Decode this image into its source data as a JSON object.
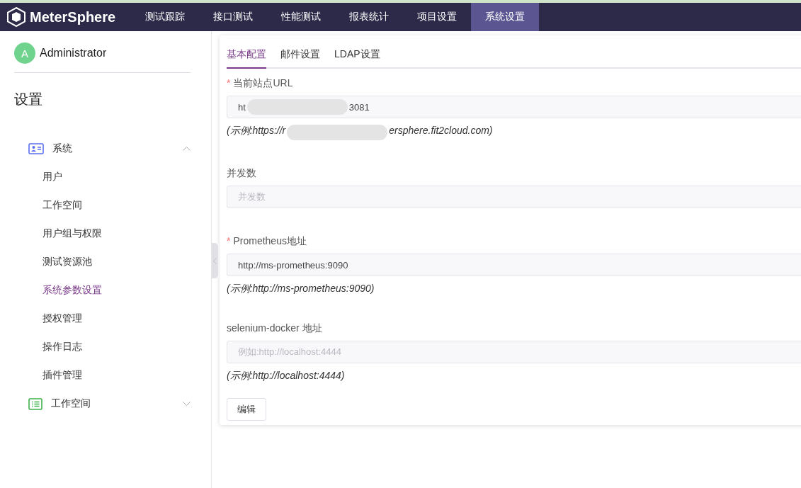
{
  "header": {
    "logo": "MeterSphere",
    "nav": [
      {
        "label": "测试跟踪",
        "selected": false
      },
      {
        "label": "接口测试",
        "selected": false
      },
      {
        "label": "性能测试",
        "selected": false
      },
      {
        "label": "报表统计",
        "selected": false
      },
      {
        "label": "项目设置",
        "selected": false
      },
      {
        "label": "系统设置",
        "selected": true
      }
    ]
  },
  "sidebar": {
    "user": {
      "initial": "A",
      "name": "Administrator"
    },
    "title": "设置",
    "groups": [
      {
        "label": "系统",
        "expanded": true,
        "children": [
          {
            "label": "用户",
            "selected": false
          },
          {
            "label": "工作空间",
            "selected": false
          },
          {
            "label": "用户组与权限",
            "selected": false
          },
          {
            "label": "测试资源池",
            "selected": false
          },
          {
            "label": "系统参数设置",
            "selected": true
          },
          {
            "label": "授权管理",
            "selected": false
          },
          {
            "label": "操作日志",
            "selected": false
          },
          {
            "label": "插件管理",
            "selected": false
          }
        ]
      },
      {
        "label": "工作空间",
        "expanded": false
      }
    ]
  },
  "tabs": [
    {
      "label": "基本配置",
      "selected": true
    },
    {
      "label": "邮件设置",
      "selected": false
    },
    {
      "label": "LDAP设置",
      "selected": false
    }
  ],
  "fields": [
    {
      "label": "当前站点URL",
      "mark": "*",
      "value": [
        "ht",
        "3081"
      ],
      "hint": [
        "(示例:https://r",
        "ersphere.fit2cloud.com)"
      ]
    },
    {
      "label": "并发数",
      "placeholder": "并发数"
    },
    {
      "label": "Prometheus地址",
      "mark": "*",
      "value": [
        "http://ms-prometheus:9090"
      ],
      "hint": [
        "(示例:http://ms-prometheus:9090)"
      ]
    },
    {
      "label": "selenium-docker 地址",
      "placeholder": "例如:http://localhost:4444",
      "hint": [
        "(示例:http://localhost:4444)"
      ]
    }
  ],
  "edit_button": "编辑"
}
